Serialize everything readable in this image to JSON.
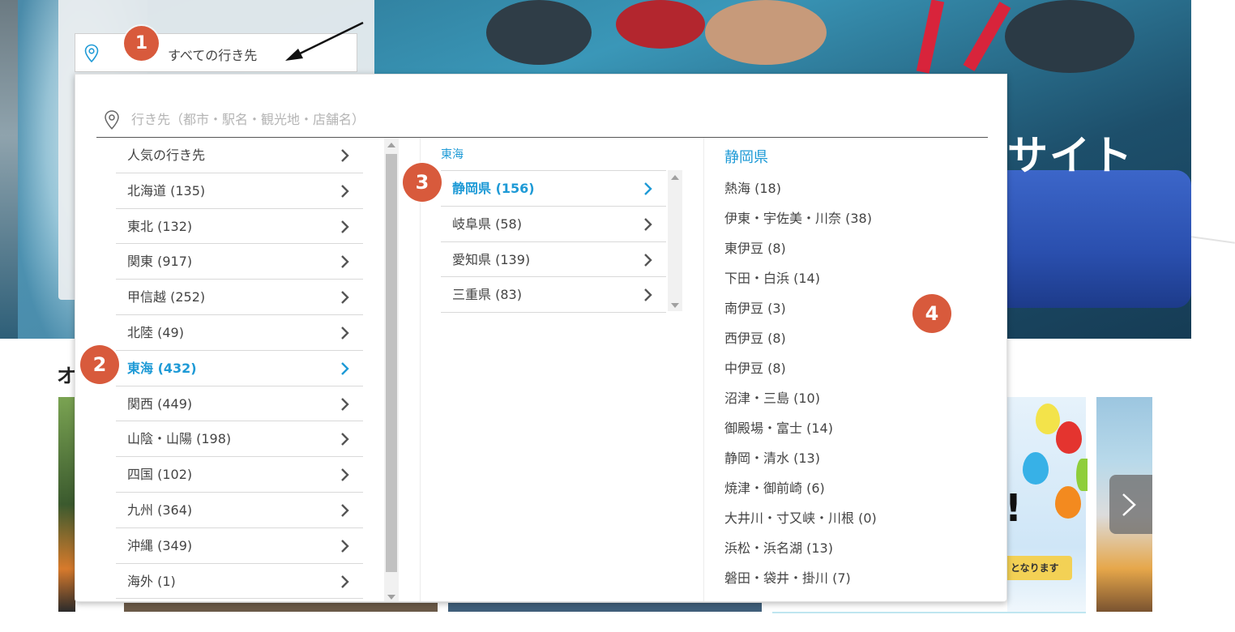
{
  "hero": {
    "title_fragment": "サイト"
  },
  "search_box": {
    "value": "すべての行き先"
  },
  "section": {
    "title_fragment": "オ"
  },
  "promo": {
    "banner_text": "となります",
    "exclamation": "!"
  },
  "dropdown": {
    "search_placeholder": "行き先（都市・駅名・観光地・店舗名）",
    "regions": [
      {
        "label": "人気の行き先",
        "active": false
      },
      {
        "label": "北海道 (135)",
        "active": false
      },
      {
        "label": "東北 (132)",
        "active": false
      },
      {
        "label": "関東 (917)",
        "active": false
      },
      {
        "label": "甲信越 (252)",
        "active": false
      },
      {
        "label": "北陸 (49)",
        "active": false
      },
      {
        "label": "東海 (432)",
        "active": true
      },
      {
        "label": "関西 (449)",
        "active": false
      },
      {
        "label": "山陰・山陽 (198)",
        "active": false
      },
      {
        "label": "四国 (102)",
        "active": false
      },
      {
        "label": "九州 (364)",
        "active": false
      },
      {
        "label": "沖縄 (349)",
        "active": false
      },
      {
        "label": "海外 (1)",
        "active": false
      }
    ],
    "prefecture_header": "東海",
    "prefectures": [
      {
        "label": "静岡県 (156)",
        "active": true
      },
      {
        "label": "岐阜県 (58)",
        "active": false
      },
      {
        "label": "愛知県 (139)",
        "active": false
      },
      {
        "label": "三重県 (83)",
        "active": false
      }
    ],
    "area_header": "静岡県",
    "areas": [
      "熱海 (18)",
      "伊東・宇佐美・川奈 (38)",
      "東伊豆 (8)",
      "下田・白浜 (14)",
      "南伊豆 (3)",
      "西伊豆 (8)",
      "中伊豆 (8)",
      "沼津・三島 (10)",
      "御殿場・富士 (14)",
      "静岡・清水 (13)",
      "焼津・御前崎 (6)",
      "大井川・寸又峡・川根 (0)",
      "浜松・浜名湖 (13)",
      "磐田・袋井・掛川 (7)"
    ]
  },
  "annotations": {
    "b1": "1",
    "b2": "2",
    "b3": "3",
    "b4": "4"
  },
  "colors": {
    "accent": "#1e9ad6",
    "badge": "#d85a3c"
  }
}
